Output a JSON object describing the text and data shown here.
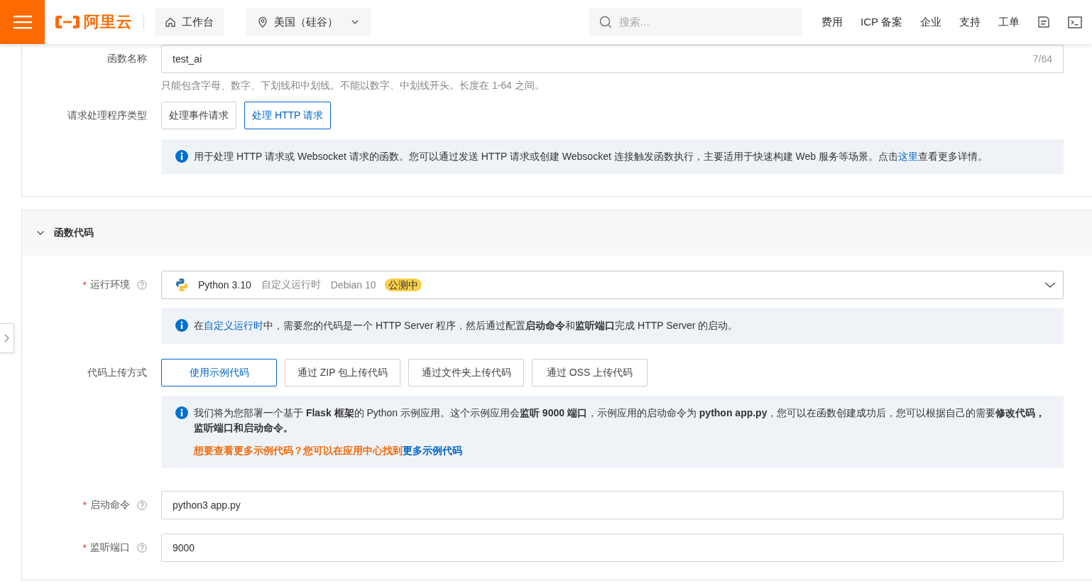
{
  "header": {
    "logo": "阿里云",
    "workbench": "工作台",
    "region": "美国（硅谷）",
    "search": {
      "placeholder": "搜索..."
    },
    "links": [
      "费用",
      "ICP 备案",
      "企业",
      "支持",
      "工单"
    ]
  },
  "basic": {
    "function_name": {
      "label": "函数名称",
      "value": "test_ai",
      "counter": "7/64",
      "hint": "只能包含字母、数字、下划线和中划线。不能以数字、中划线开头。长度在 1-64 之间。"
    },
    "handler_type": {
      "label": "请求处理程序类型",
      "options": [
        {
          "label": "处理事件请求",
          "selected": false
        },
        {
          "label": "处理 HTTP 请求",
          "selected": true
        }
      ],
      "info": [
        [
          {
            "kind": "text",
            "text": "用于处理 HTTP 请求或 Websocket 请求的函数。您可以通过发送 HTTP 请求或创建 Websocket 连接触发函数执行，主要适用于快速构建 Web 服务等场景。点击"
          },
          {
            "kind": "link",
            "text": "这里"
          },
          {
            "kind": "text",
            "text": "查看更多详情。"
          }
        ]
      ]
    }
  },
  "code_section": {
    "title": "函数代码",
    "expanded": true,
    "runtime": {
      "marker": "*",
      "label": "运行环境",
      "name": "Python 3.10",
      "type": "自定义运行时",
      "os": "Debian 10",
      "badge": "公测中",
      "info": [
        [
          {
            "kind": "text",
            "text": "在"
          },
          {
            "kind": "link",
            "text": "自定义运行时"
          },
          {
            "kind": "text",
            "text": "中，需要您的代码是一个 HTTP Server 程序，然后通过配置"
          },
          {
            "kind": "bold",
            "text": "启动命令"
          },
          {
            "kind": "text",
            "text": "和"
          },
          {
            "kind": "bold",
            "text": "监听端口"
          },
          {
            "kind": "text",
            "text": "完成 HTTP Server 的启动。"
          }
        ]
      ]
    },
    "upload": {
      "label": "代码上传方式",
      "options": [
        {
          "label": "使用示例代码",
          "selected": true
        },
        {
          "label": "通过 ZIP 包上传代码",
          "selected": false
        },
        {
          "label": "通过文件夹上传代码",
          "selected": false
        },
        {
          "label": "通过 OSS 上传代码",
          "selected": false
        }
      ],
      "info": [
        [
          {
            "kind": "text",
            "text": "我们将为您部署一个基于 "
          },
          {
            "kind": "bold",
            "text": "Flask 框架"
          },
          {
            "kind": "text",
            "text": "的 Python 示例应用。这个示例应用会"
          },
          {
            "kind": "bold",
            "text": "监听 9000 端口"
          },
          {
            "kind": "text",
            "text": "，示例应用的启动命令为 "
          },
          {
            "kind": "bold",
            "text": "python app.py"
          },
          {
            "kind": "text",
            "text": "，您可以在函数创建成功后，您可以根据自己的需要"
          },
          {
            "kind": "bold",
            "text": "修改代码，监听端口和启动命令。"
          }
        ],
        [
          {
            "kind": "warning",
            "text": "想要查看更多示例代码？您可以在应用中心找到"
          },
          {
            "kind": "link",
            "text": "更多示例代码"
          }
        ]
      ]
    },
    "start_command": {
      "marker": "*",
      "label": "启动命令",
      "value": "python3 app.py"
    },
    "port": {
      "marker": "*",
      "label": "监听端口",
      "value": "9000"
    }
  }
}
